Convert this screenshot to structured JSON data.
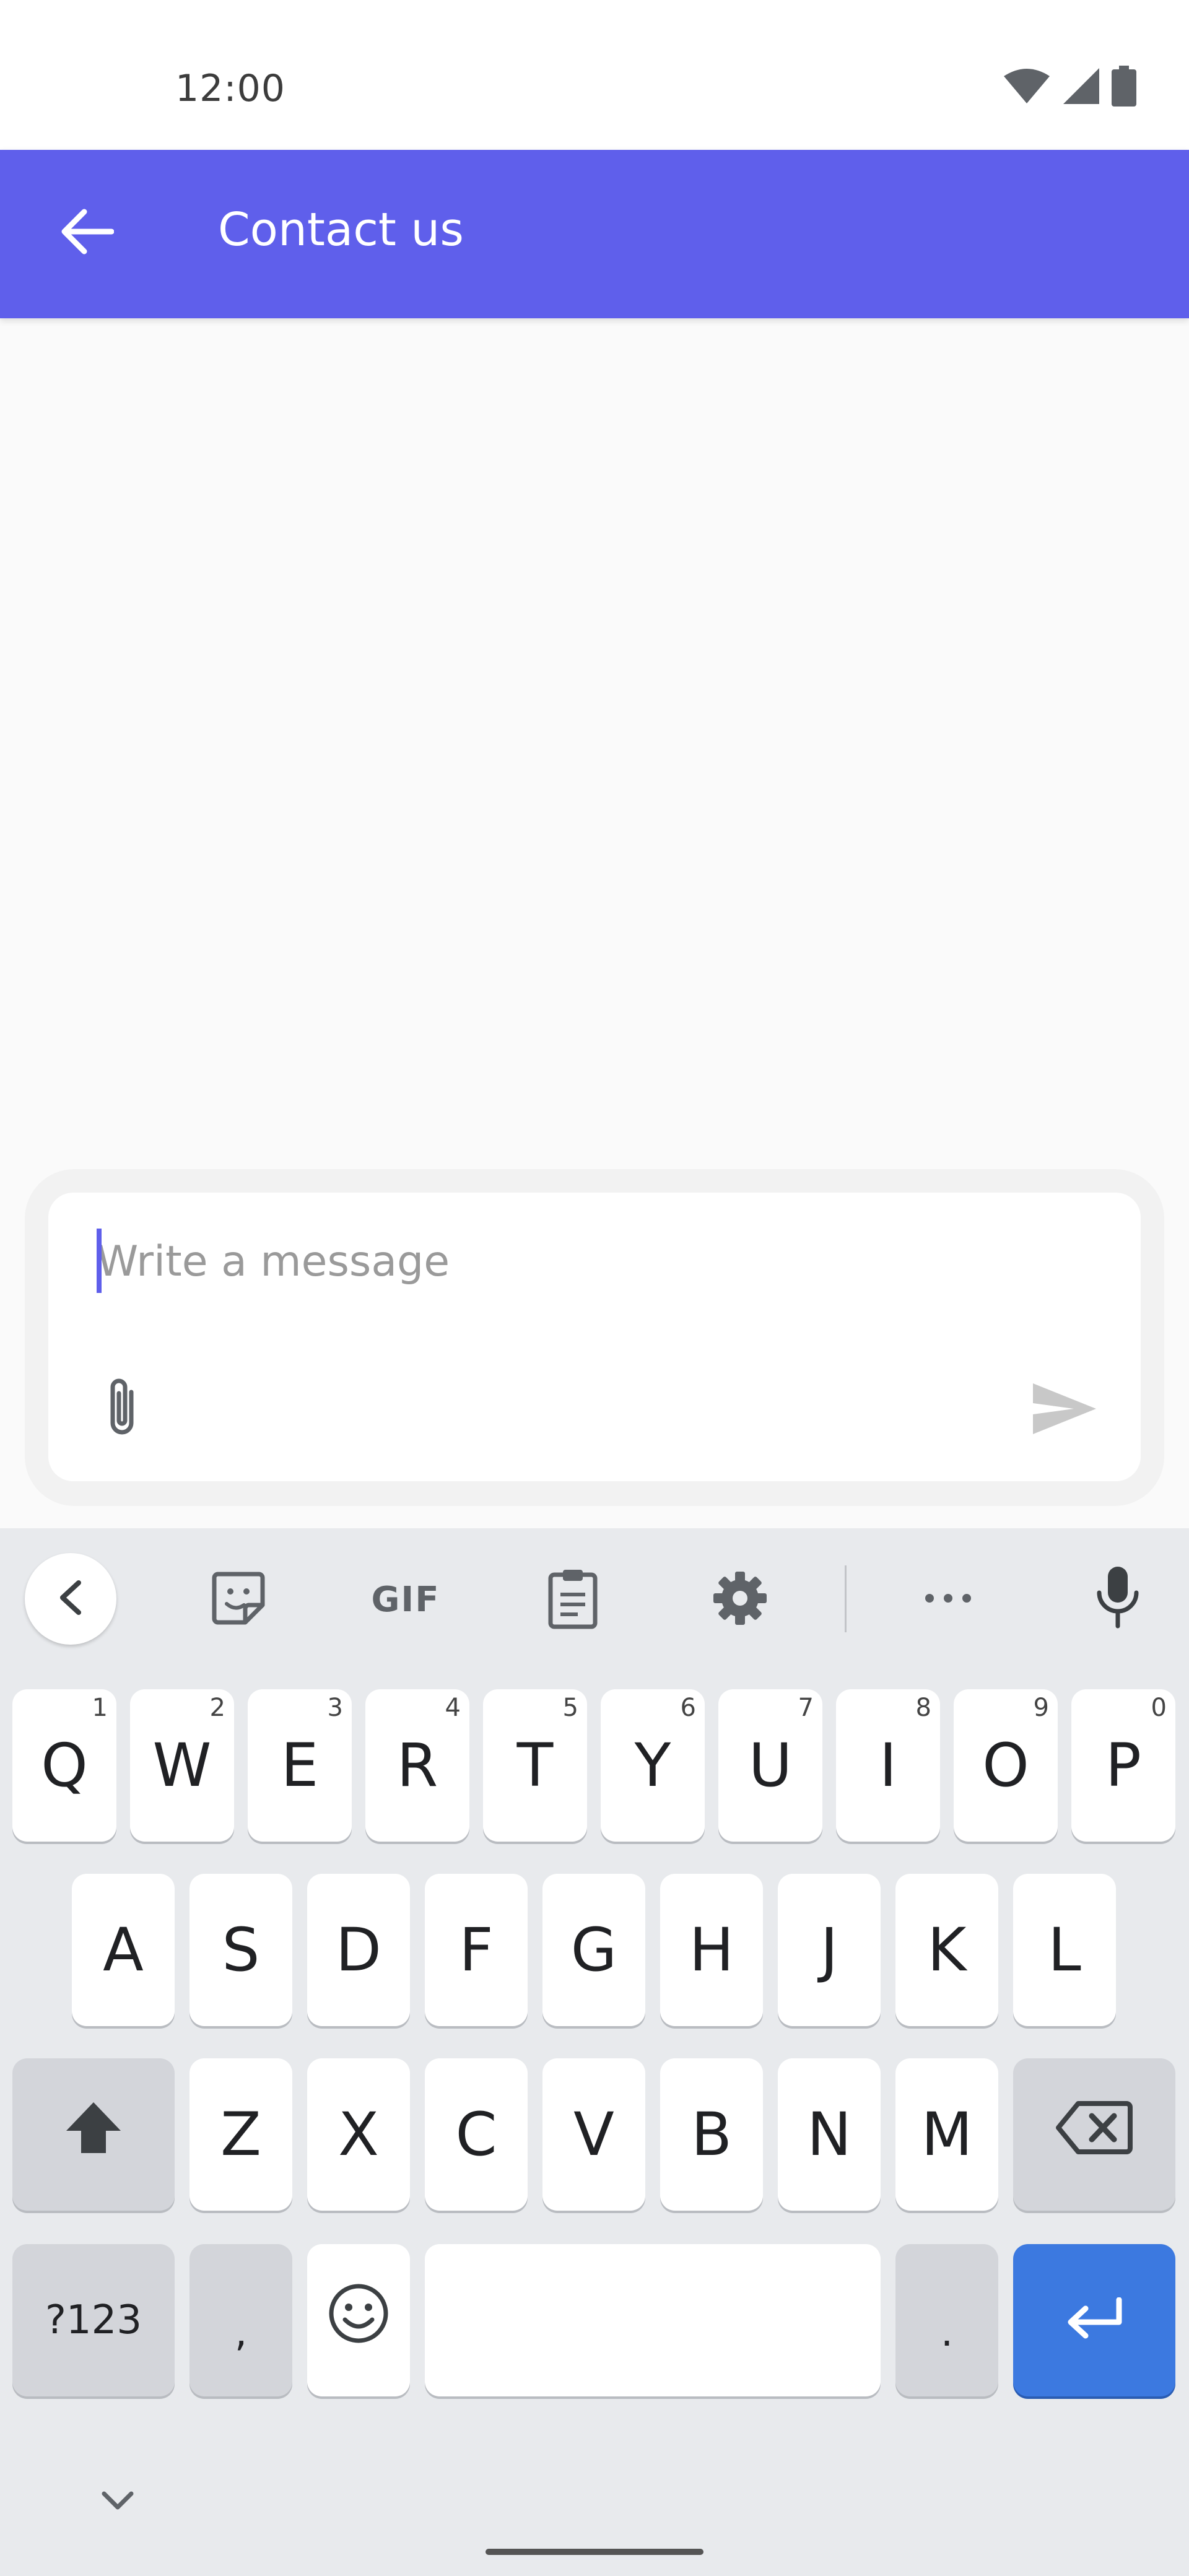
{
  "status_bar": {
    "time": "12:00",
    "icons": [
      "wifi-icon",
      "signal-icon",
      "battery-icon"
    ]
  },
  "app_bar": {
    "title": "Contact us",
    "back_icon": "arrow-left-icon"
  },
  "composer": {
    "placeholder": "Write a message",
    "value": "",
    "attach_icon": "paperclip-icon",
    "send_icon": "send-icon"
  },
  "keyboard": {
    "toolbar": {
      "collapse_icon": "chevron-left-icon",
      "sticker_icon": "sticker-icon",
      "gif_label": "GIF",
      "clipboard_icon": "clipboard-icon",
      "settings_icon": "gear-icon",
      "more_icon": "more-dots-icon",
      "mic_icon": "microphone-icon"
    },
    "row1": [
      {
        "label": "Q",
        "hint": "1"
      },
      {
        "label": "W",
        "hint": "2"
      },
      {
        "label": "E",
        "hint": "3"
      },
      {
        "label": "R",
        "hint": "4"
      },
      {
        "label": "T",
        "hint": "5"
      },
      {
        "label": "Y",
        "hint": "6"
      },
      {
        "label": "U",
        "hint": "7"
      },
      {
        "label": "I",
        "hint": "8"
      },
      {
        "label": "O",
        "hint": "9"
      },
      {
        "label": "P",
        "hint": "0"
      }
    ],
    "row2": [
      "A",
      "S",
      "D",
      "F",
      "G",
      "H",
      "J",
      "K",
      "L"
    ],
    "row3": [
      "Z",
      "X",
      "C",
      "V",
      "B",
      "N",
      "M"
    ],
    "row4": {
      "symbols_label": "?123",
      "comma_label": ",",
      "period_label": "."
    },
    "colors": {
      "accent": "#5f5feb",
      "enter": "#3c79e0"
    }
  }
}
